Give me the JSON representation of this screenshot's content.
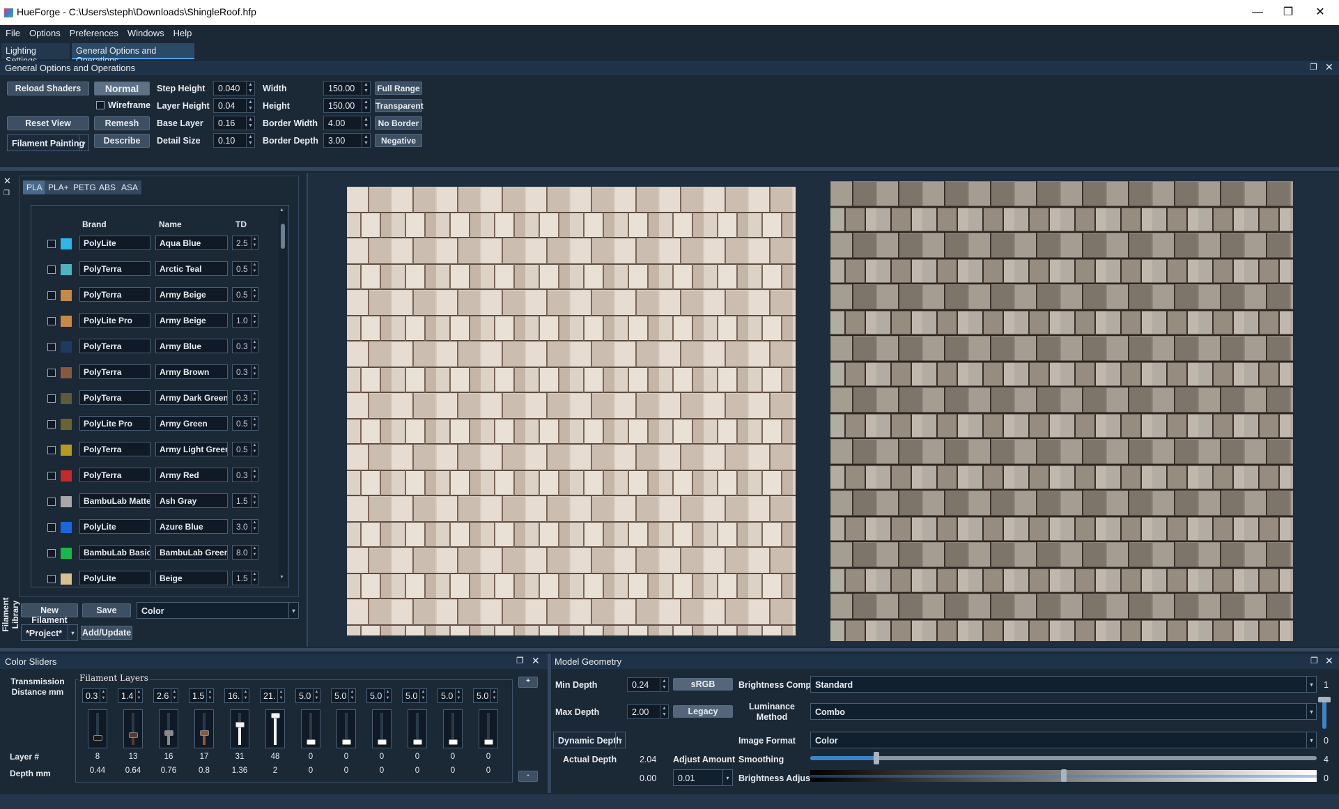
{
  "window": {
    "title": "HueForge - C:\\Users\\steph\\Downloads\\ShingleRoof.hfp",
    "minimize": "—",
    "restore": "❐",
    "close": "✕"
  },
  "menu": [
    "File",
    "Options",
    "Preferences",
    "Windows",
    "Help"
  ],
  "tabs": [
    "Lighting Settings",
    "General Options and Operations"
  ],
  "general": {
    "header": "General Options and Operations",
    "reload_shaders": "Reload Shaders",
    "normal": "Normal",
    "wireframe": "Wireframe",
    "reset_view": "Reset View",
    "remesh": "Remesh",
    "mode": "Filament Painting",
    "describe": "Describe",
    "step_height_label": "Step Height",
    "step_height": "0.040",
    "layer_height_label": "Layer Height",
    "layer_height": "0.04",
    "base_layer_label": "Base Layer",
    "base_layer": "0.16",
    "detail_size_label": "Detail Size",
    "detail_size": "0.10",
    "width_label": "Width",
    "width": "150.00",
    "height_label": "Height",
    "height": "150.00",
    "border_width_label": "Border Width",
    "border_width": "4.00",
    "border_depth_label": "Border Depth",
    "border_depth": "3.00",
    "full_range": "Full Range",
    "transparent": "Transparent",
    "no_border": "No Border",
    "negative": "Negative"
  },
  "library": {
    "side_label": "Filament Library",
    "material_tabs": [
      "PLA",
      "PLA+",
      "PETG",
      "ABS",
      "ASA"
    ],
    "columns": {
      "brand": "Brand",
      "name": "Name",
      "td": "TD"
    },
    "rows": [
      {
        "brand": "PolyLite",
        "name": "Aqua Blue",
        "td": "2.5",
        "color": "#2db8e8"
      },
      {
        "brand": "PolyTerra",
        "name": "Arctic Teal",
        "td": "0.5",
        "color": "#4fb3bf"
      },
      {
        "brand": "PolyTerra",
        "name": "Army Beige",
        "td": "0.5",
        "color": "#c48a4a"
      },
      {
        "brand": "PolyLite Pro",
        "name": "Army Beige",
        "td": "1.0",
        "color": "#c88a48"
      },
      {
        "brand": "PolyTerra",
        "name": "Army Blue",
        "td": "0.3",
        "color": "#1f3a60"
      },
      {
        "brand": "PolyTerra",
        "name": "Army Brown",
        "td": "0.3",
        "color": "#8a5a40"
      },
      {
        "brand": "PolyTerra",
        "name": "Army Dark Green",
        "td": "0.3",
        "color": "#5a5c3a"
      },
      {
        "brand": "PolyLite Pro",
        "name": "Army Green",
        "td": "0.5",
        "color": "#6a6430"
      },
      {
        "brand": "PolyTerra",
        "name": "Army Light Green",
        "td": "0.5",
        "color": "#b89a20"
      },
      {
        "brand": "PolyTerra",
        "name": "Army Red",
        "td": "0.3",
        "color": "#c42a2a"
      },
      {
        "brand": "BambuLab Matte",
        "name": "Ash Gray",
        "td": "1.5",
        "color": "#a8a8a8"
      },
      {
        "brand": "PolyLite",
        "name": "Azure Blue",
        "td": "3.0",
        "color": "#1a66e0"
      },
      {
        "brand": "BambuLab Basic",
        "name": "BambuLab Green",
        "td": "8.0",
        "color": "#18b84a"
      },
      {
        "brand": "PolyLite",
        "name": "Beige",
        "td": "1.5",
        "color": "#d8c090"
      }
    ],
    "new_filament": "New Filament",
    "save": "Save",
    "sort_mode": "Color",
    "project": "*Project*",
    "add_update": "Add/Update"
  },
  "color_sliders": {
    "header": "Color Sliders",
    "transmission_label": "Transmission Distance mm",
    "filament_layers_label": "Filament Layers",
    "layer_label": "Layer #",
    "depth_label": "Depth mm",
    "plus": "+",
    "minus": "-",
    "layers": [
      {
        "td": "0.3",
        "layer": "8",
        "depth": "0.44",
        "color": "#1a1a1a",
        "level": 0.17
      },
      {
        "td": "1.4",
        "layer": "13",
        "depth": "0.64",
        "color": "#5a3a30",
        "level": 0.27
      },
      {
        "td": "2.6",
        "layer": "16",
        "depth": "0.76",
        "color": "#8a8a8a",
        "level": 0.33
      },
      {
        "td": "1.5",
        "layer": "17",
        "depth": "0.8",
        "color": "#8a5a40",
        "level": 0.35
      },
      {
        "td": "16.",
        "layer": "31",
        "depth": "1.36",
        "color": "#f4f4f4",
        "level": 0.65
      },
      {
        "td": "21.",
        "layer": "48",
        "depth": "2",
        "color": "#f8f8f8",
        "level": 1.0
      },
      {
        "td": "5.0",
        "layer": "0",
        "depth": "0",
        "color": "#ffffff",
        "level": 0
      },
      {
        "td": "5.0",
        "layer": "0",
        "depth": "0",
        "color": "#ffffff",
        "level": 0
      },
      {
        "td": "5.0",
        "layer": "0",
        "depth": "0",
        "color": "#ffffff",
        "level": 0
      },
      {
        "td": "5.0",
        "layer": "0",
        "depth": "0",
        "color": "#ffffff",
        "level": 0
      },
      {
        "td": "5.0",
        "layer": "0",
        "depth": "0",
        "color": "#ffffff",
        "level": 0
      },
      {
        "td": "5.0",
        "layer": "0",
        "depth": "0",
        "color": "#ffffff",
        "level": 0
      }
    ]
  },
  "model_geometry": {
    "header": "Model Geometry",
    "min_depth_label": "Min Depth",
    "min_depth": "0.24",
    "srgb": "sRGB",
    "max_depth_label": "Max Depth",
    "max_depth": "2.00",
    "legacy": "Legacy",
    "dynamic_depth": "Dynamic Depth",
    "actual_depth_label": "Actual Depth",
    "actual_depth": "2.04",
    "adjust_amount_label": "Adjust Amount",
    "adjust_value": "0.00",
    "adjust_amount": "0.01",
    "brightness_comp_label": "Brightness Comp",
    "brightness_comp": "Standard",
    "luminance_label": "Luminance Method",
    "luminance": "Combo",
    "image_format_label": "Image Format",
    "image_format": "Color",
    "smoothing_label": "Smoothing",
    "smoothing_level": 0.13,
    "brightness_adjust_label": "Brightness Adjust",
    "brightness_adjust_level": 0.5,
    "right_values": [
      "1",
      "0",
      "4",
      "0"
    ]
  }
}
